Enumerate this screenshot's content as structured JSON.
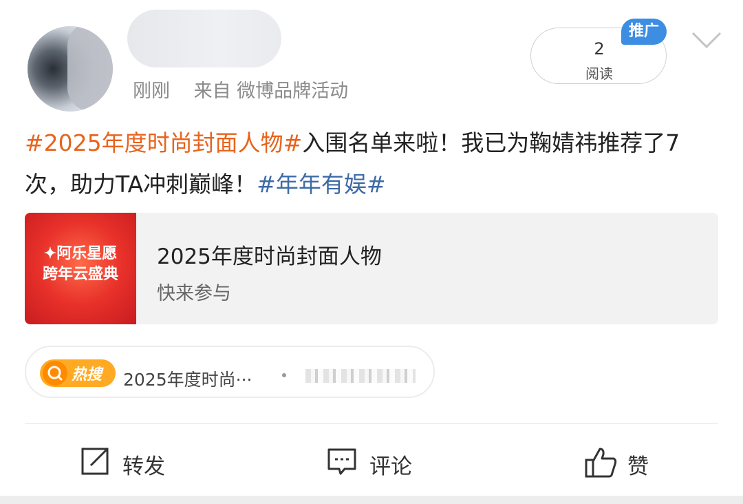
{
  "post": {
    "meta_time": "刚刚",
    "meta_source": "来自 微博品牌活动",
    "read_count": "2",
    "read_label": "阅读",
    "promo_badge": "推广",
    "content_line1_tag": "#2025年度时尚封面人物#",
    "content_line1_text": "入围名单来啦！我已为鞠婧祎推荐了7次，助力TA冲刺巅峰！",
    "content_tag2": "#年年有娱#"
  },
  "card": {
    "image_text_line1": "✦阿乐星愿",
    "image_text_line2": "跨年云盛典",
    "title": "2025年度时尚封面人物",
    "subtitle": "快来参与"
  },
  "hot_search": {
    "badge": "热搜",
    "text": "2025年度时尚···"
  },
  "actions": {
    "repost": "转发",
    "comment": "评论",
    "like": "赞"
  },
  "colors": {
    "orange_tag": "#e8631c",
    "blue_tag": "#3d6ba6",
    "promo_blue": "#3d8de3",
    "hot_orange": "#ffaa22"
  }
}
